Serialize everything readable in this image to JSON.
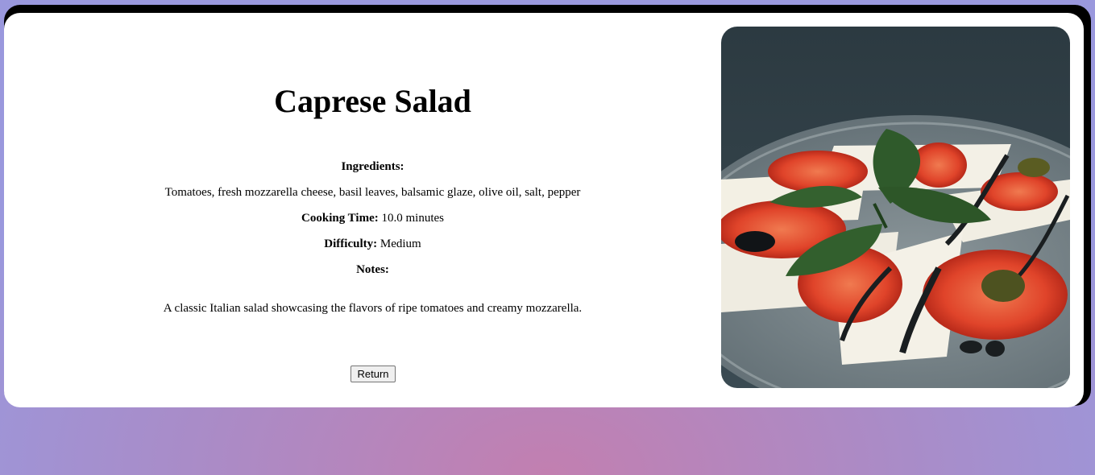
{
  "recipe": {
    "title": "Caprese Salad",
    "ingredients_label": "Ingredients:",
    "ingredients": "Tomatoes, fresh mozzarella cheese, basil leaves, balsamic glaze, olive oil, salt, pepper",
    "cooking_time_label": "Cooking Time:",
    "cooking_time": "10.0 minutes",
    "difficulty_label": "Difficulty:",
    "difficulty": "Medium",
    "notes_label": "Notes:",
    "notes": "A classic Italian salad showcasing the flavors of ripe tomatoes and creamy mozzarella."
  },
  "actions": {
    "return_label": "Return"
  },
  "image": {
    "subject": "caprese-salad-photo"
  },
  "colors": {
    "card": "#ffffff",
    "card_shadow": "#000000",
    "text": "#000000"
  }
}
